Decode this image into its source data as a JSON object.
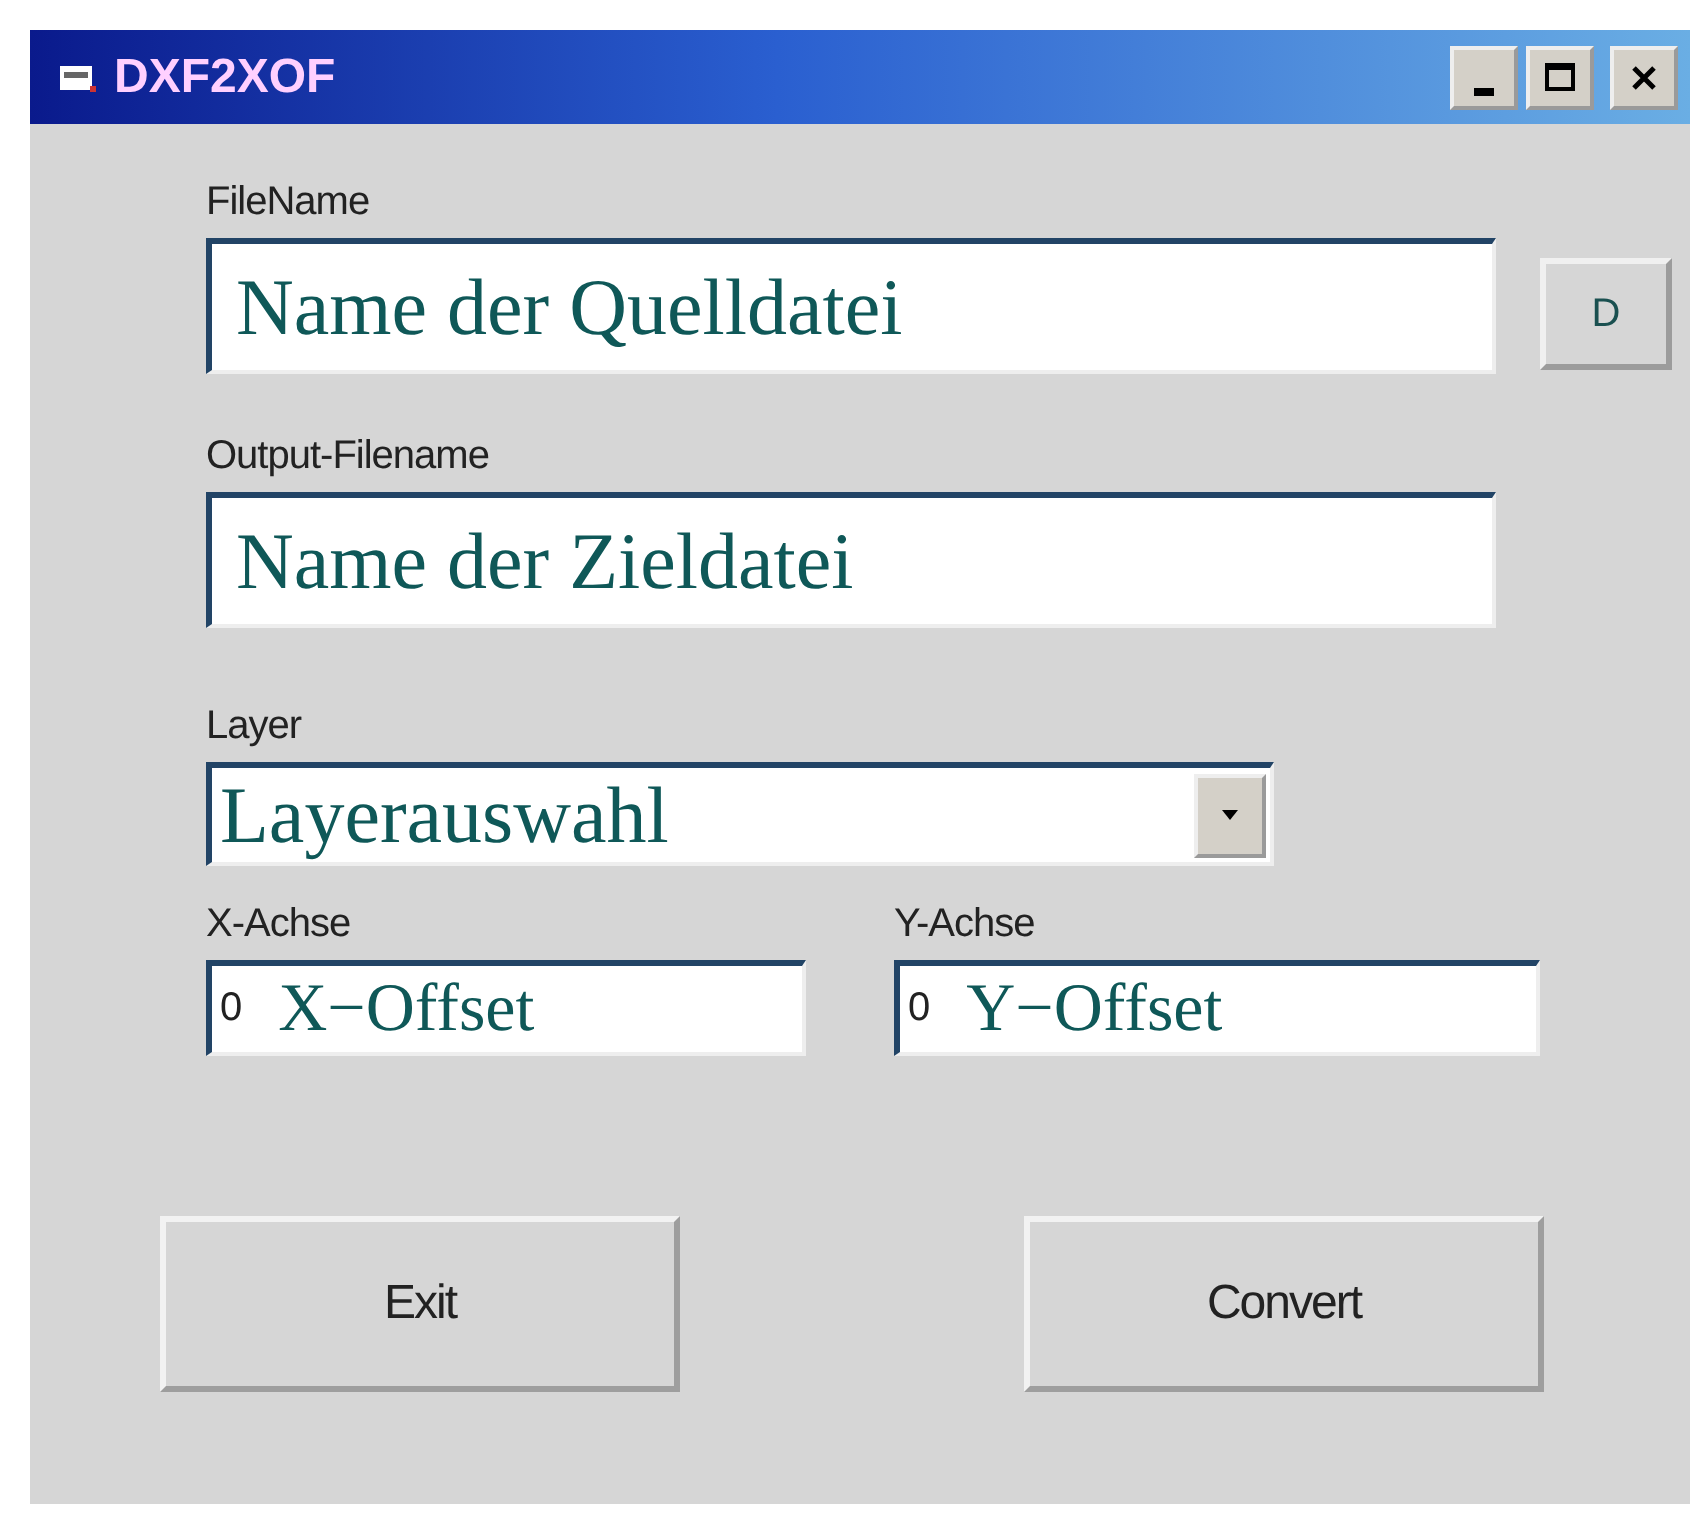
{
  "window": {
    "title": "DXF2XOF"
  },
  "file_name": {
    "label": "FileName",
    "annotation": "Name der Quelldatei",
    "browse_button": "D"
  },
  "output_filename": {
    "label": "Output-Filename",
    "annotation": "Name der Zieldatei"
  },
  "layer": {
    "label": "Layer",
    "annotation": "Layerauswahl"
  },
  "offsets": [
    {
      "label": "X-Achse",
      "value": "0",
      "annotation": "X−Offset"
    },
    {
      "label": "Y-Achse",
      "value": "0",
      "annotation": "Y−Offset"
    }
  ],
  "buttons": [
    "Exit",
    "Convert"
  ]
}
